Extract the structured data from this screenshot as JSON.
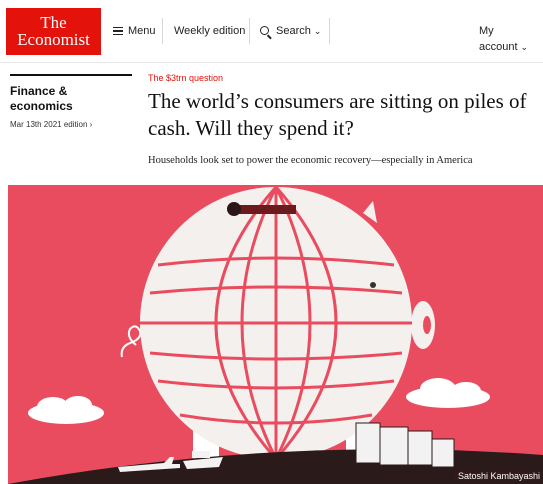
{
  "brand": {
    "line1": "The",
    "line2": "Economist"
  },
  "nav": {
    "menu_label": "Menu",
    "weekly_label": "Weekly edition",
    "search_label": "Search",
    "account_label": "My account"
  },
  "section": {
    "name": "Finance & economics",
    "edition": "Mar 13th 2021 edition ›"
  },
  "article": {
    "fly_title": "The $3trn question",
    "headline": "The world’s consumers are sitting on piles of cash. Will they spend it?",
    "rubric": "Households look set to power the economic recovery—especially in America"
  },
  "illustration": {
    "credit": "Satoshi Kambayashi",
    "background_color": "#ea4c5f"
  },
  "colors": {
    "brand_red": "#e3120b"
  }
}
